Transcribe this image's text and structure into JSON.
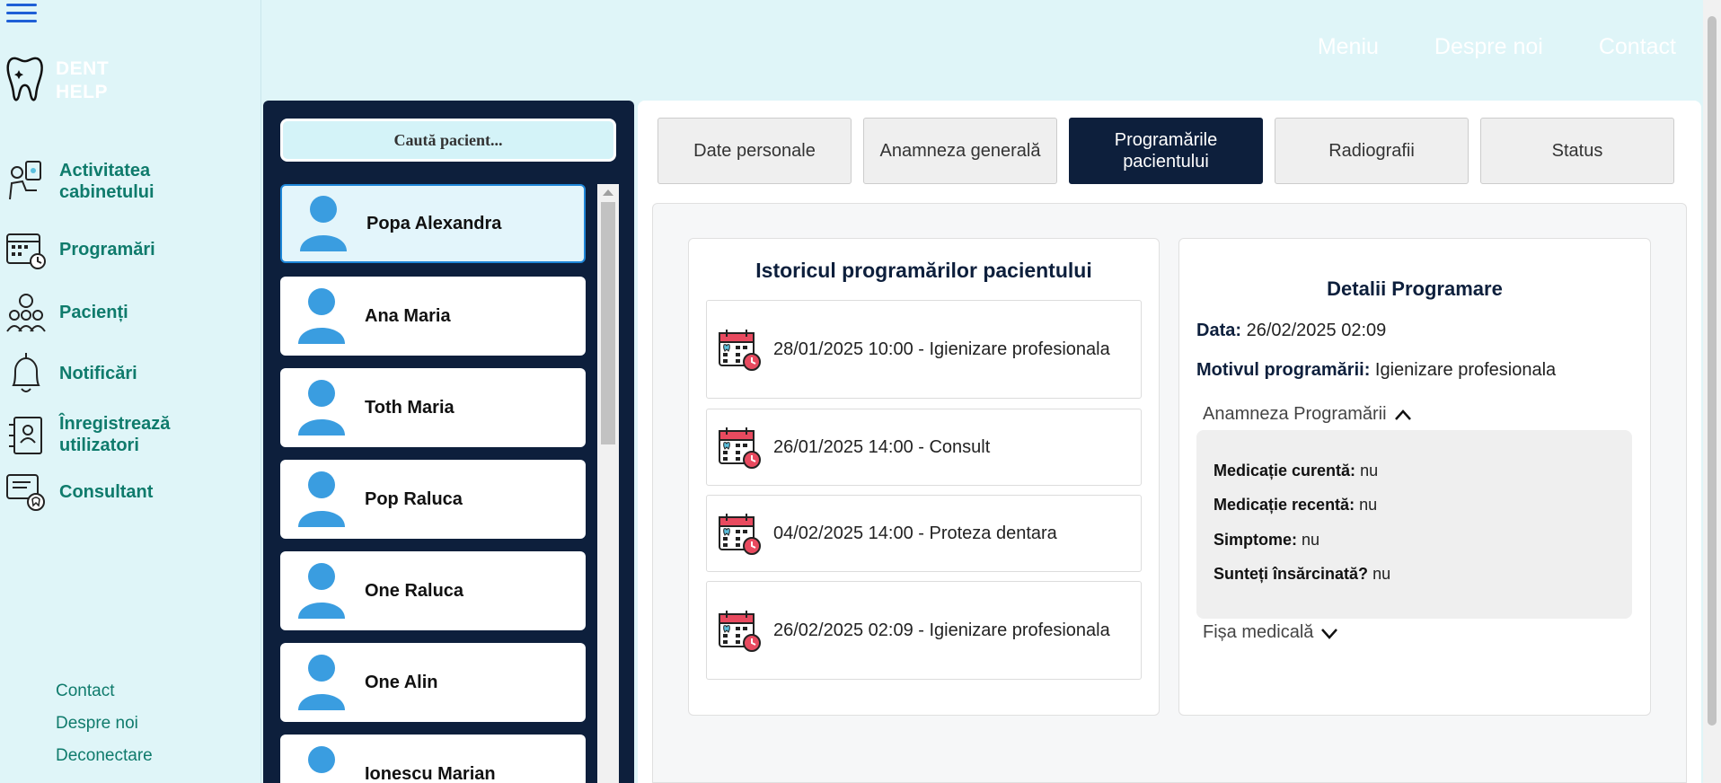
{
  "app": {
    "logo_text": "DENT HELP",
    "logo_line1": "DENT",
    "logo_line2": "HELP"
  },
  "sidebar": {
    "items": [
      {
        "label": "Activitatea cabinetului",
        "icon": "dentist-activity-icon"
      },
      {
        "label": "Programări",
        "icon": "calendar-clock-icon"
      },
      {
        "label": "Pacienți",
        "icon": "patients-icon"
      },
      {
        "label": "Notificări",
        "icon": "bell-icon"
      },
      {
        "label": "Înregistrează utilizatori",
        "icon": "register-user-icon"
      },
      {
        "label": "Consultant",
        "icon": "consultant-icon"
      }
    ],
    "footer": [
      "Contact",
      "Despre noi",
      "Deconectare"
    ]
  },
  "topnav": [
    "Meniu",
    "Despre noi",
    "Contact"
  ],
  "patients": {
    "search_label": "Caută pacient...",
    "list": [
      "Popa Alexandra",
      "Ana Maria",
      "Toth Maria",
      "Pop Raluca",
      "One Raluca",
      "One Alin",
      "Ionescu Marian"
    ],
    "selected": "Popa Alexandra"
  },
  "tabs": [
    {
      "label": "Date personale"
    },
    {
      "label": "Anamneza generală"
    },
    {
      "label": "Programările pacientului",
      "active": true
    },
    {
      "label": "Radiografii"
    },
    {
      "label": "Status"
    }
  ],
  "history": {
    "title": "Istoricul programărilor pacientului",
    "appointments": [
      "28/01/2025 10:00 - Igienizare profesionala",
      "26/01/2025 14:00 - Consult",
      "04/02/2025 14:00 - Proteza dentara",
      "26/02/2025 02:09 - Igienizare profesionala"
    ]
  },
  "details": {
    "title": "Detalii Programare",
    "date_label": "Data:",
    "date_value": "26/02/2025 02:09",
    "reason_label": "Motivul programării:",
    "reason_value": "Igienizare profesionala",
    "anamnesis_toggle": "Anamneza Programării",
    "anamnesis": [
      {
        "label": "Medicație curentă:",
        "value": "nu"
      },
      {
        "label": "Medicație recentă:",
        "value": "nu"
      },
      {
        "label": "Simptome:",
        "value": "nu"
      },
      {
        "label": "Sunteți însărcinată?",
        "value": "nu"
      }
    ],
    "medical_file_toggle": "Fișa medicală"
  },
  "colors": {
    "navy": "#0d1f3c",
    "teal": "#0f7b6c",
    "bg": "#dff5f8",
    "accent_red": "#e84a5f"
  }
}
